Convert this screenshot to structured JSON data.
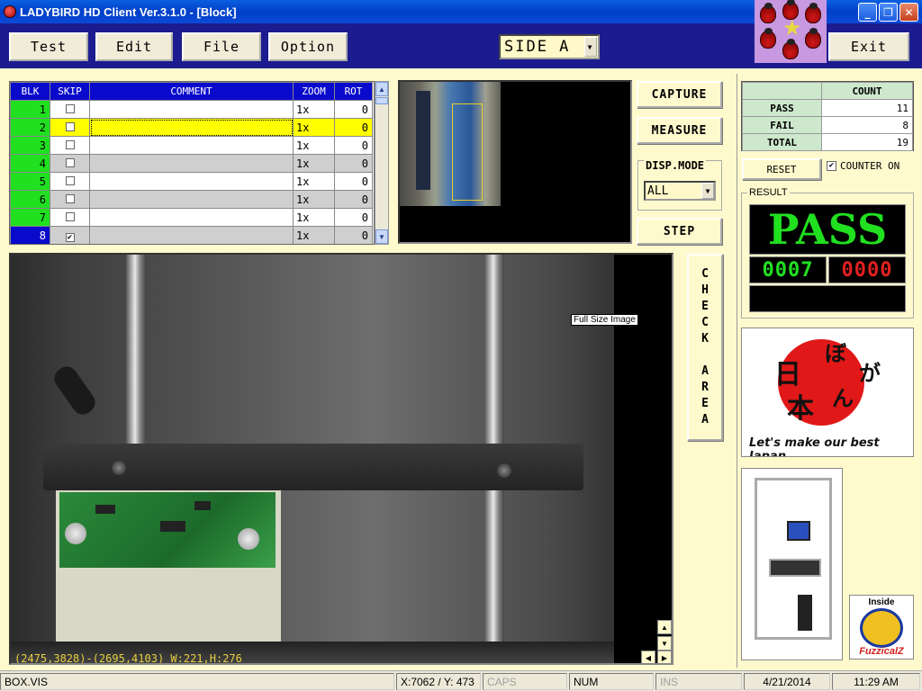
{
  "window": {
    "title": "LADYBIRD HD Client Ver.3.1.0 - [Block]",
    "controls": [
      "minimize",
      "maximize",
      "close"
    ]
  },
  "toolbar": {
    "test_label": "Test",
    "edit_label": "Edit",
    "file_label": "File",
    "option_label": "Option",
    "exit_label": "Exit",
    "side_select": "SIDE A"
  },
  "grid": {
    "headers": [
      "BLK",
      "SKIP",
      "COMMENT",
      "ZOOM",
      "ROT"
    ],
    "rows": [
      {
        "blk": "1",
        "skip": false,
        "comment": "",
        "zoom": "1x",
        "rot": "0"
      },
      {
        "blk": "2",
        "skip": false,
        "comment": "",
        "zoom": "1x",
        "rot": "0"
      },
      {
        "blk": "3",
        "skip": false,
        "comment": "",
        "zoom": "1x",
        "rot": "0"
      },
      {
        "blk": "4",
        "skip": false,
        "comment": "",
        "zoom": "1x",
        "rot": "0"
      },
      {
        "blk": "5",
        "skip": false,
        "comment": "",
        "zoom": "1x",
        "rot": "0"
      },
      {
        "blk": "6",
        "skip": false,
        "comment": "",
        "zoom": "1x",
        "rot": "0"
      },
      {
        "blk": "7",
        "skip": false,
        "comment": "",
        "zoom": "1x",
        "rot": "0"
      },
      {
        "blk": "8",
        "skip": true,
        "comment": "",
        "zoom": "1x",
        "rot": "0"
      }
    ]
  },
  "buttons": {
    "capture": "CAPTURE",
    "measure": "MEASURE",
    "step": "STEP",
    "check_area": [
      "C",
      "H",
      "E",
      "C",
      "K",
      "",
      "A",
      "R",
      "E",
      "A"
    ]
  },
  "disp_mode": {
    "label": "DISP.MODE",
    "value": "ALL"
  },
  "image": {
    "tooltip": "Full Size Image",
    "coord_readout": "(2475,3828)-(2695,4103) W:221,H:276"
  },
  "counter": {
    "header": "COUNT",
    "rows": [
      {
        "label": "PASS",
        "value": "11"
      },
      {
        "label": "FAIL",
        "value": "8"
      },
      {
        "label": "TOTAL",
        "value": "19"
      }
    ],
    "reset_label": "RESET",
    "counter_on_label": "COUNTER ON",
    "counter_on_checked": true
  },
  "result": {
    "label": "RESULT",
    "status": "PASS",
    "pass_count": "0007",
    "fail_count": "0000",
    "pass_color": "#20e020",
    "fail_color": "#e02020"
  },
  "ads": {
    "japan_slogan": "Let's make our best Japan",
    "fuzz_inside": "Inside",
    "fuzz_name": "FuzzicalZ"
  },
  "statusbar": {
    "file": "BOX.VIS",
    "coords": "X:7062 / Y: 473",
    "caps": "CAPS",
    "num": "NUM",
    "ins": "INS",
    "date": "4/21/2014",
    "time": "11:29 AM"
  }
}
